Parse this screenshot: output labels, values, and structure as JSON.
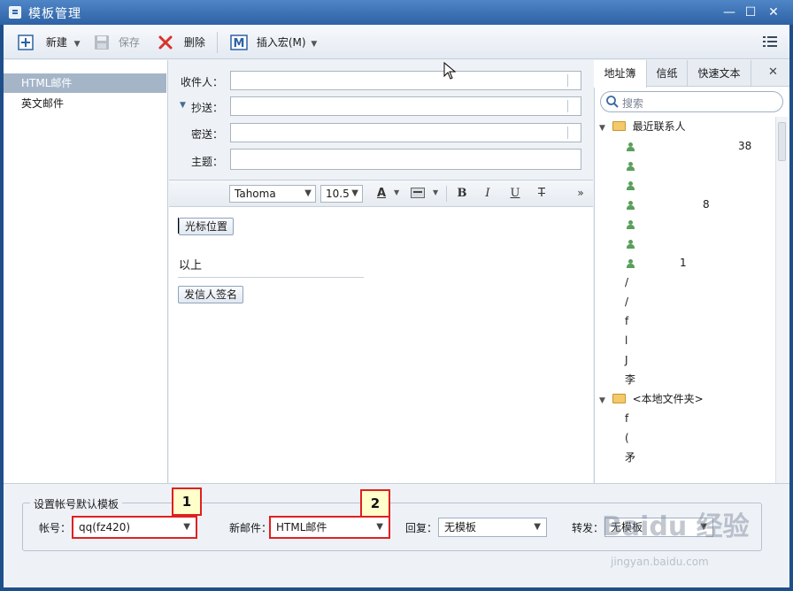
{
  "window": {
    "title": "模板管理",
    "minimize": "—",
    "maximize": "☐",
    "close": "✕"
  },
  "toolbar": {
    "new_label": "新建",
    "save_label": "保存",
    "delete_label": "删除",
    "insert_macro_label": "插入宏(M)",
    "menu_icon": "list-icon"
  },
  "templates": [
    {
      "label": "HTML邮件",
      "selected": true
    },
    {
      "label": "英文邮件",
      "selected": false
    }
  ],
  "headers": {
    "to_label": "收件人：",
    "cc_label": "抄送：",
    "bcc_label": "密送：",
    "subject_label": "主题："
  },
  "format": {
    "font": "Tahoma",
    "size": "10.5",
    "more": "»"
  },
  "body": {
    "cursor_macro": "光标位置",
    "text": "以上",
    "signature_macro": "发信人签名"
  },
  "right": {
    "tabs": [
      "地址簿",
      "信纸",
      "快速文本"
    ],
    "close": "✕",
    "search_placeholder": "搜索",
    "recent_group": "最近联系人",
    "recent_contacts": [
      "38",
      "",
      "",
      "8",
      "",
      "",
      "1"
    ],
    "other_fragments": [
      "/",
      "/",
      "f",
      "l",
      "J",
      "李"
    ],
    "local_group": "<本地文件夹>",
    "local_fragments": [
      "f",
      "(",
      "矛"
    ]
  },
  "bottom": {
    "group_title": "设置帐号默认模板",
    "account_label": "帐号：",
    "account_value": "qq(fz420)",
    "new_mail_label": "新邮件：",
    "new_mail_value": "HTML邮件",
    "reply_label": "回复：",
    "reply_value": "无模板",
    "forward_label": "转发：",
    "forward_value": "无模板"
  },
  "callouts": [
    "1",
    "2"
  ],
  "watermark": {
    "main": "Baidu 经验",
    "sub": "jingyan.baidu.com"
  },
  "colors": {
    "titlebar": "#2d62a6",
    "selection": "#a5b5c8",
    "callout_border": "#e02020",
    "callout_fill": "#ffffcc"
  }
}
